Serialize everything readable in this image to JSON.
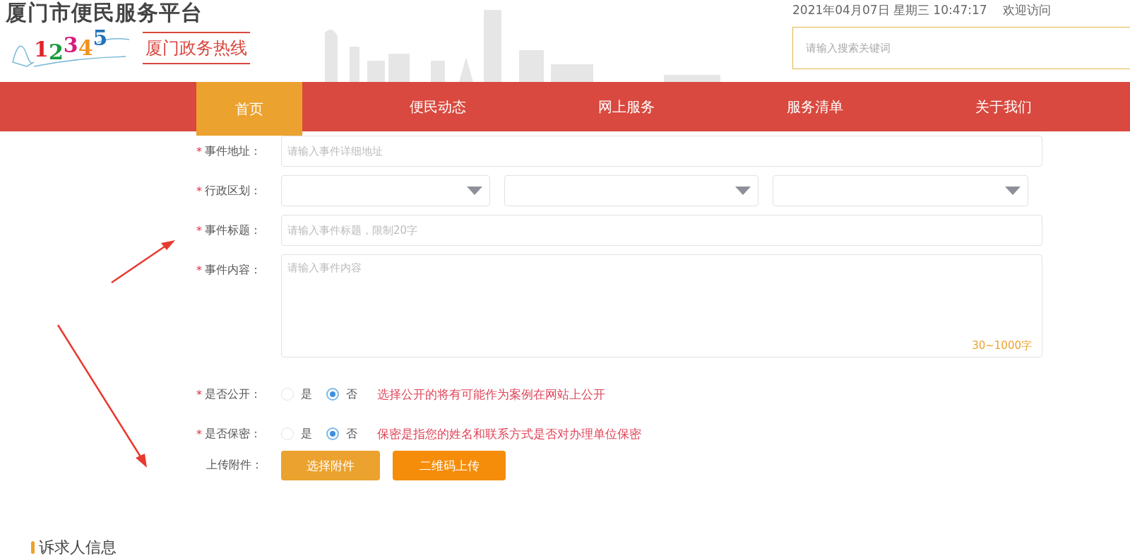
{
  "header": {
    "site_title": "厦门市便民服务平台",
    "logo_digits": [
      {
        "text": "1",
        "color": "#e2242b"
      },
      {
        "text": "2",
        "color": "#1a9a3c"
      },
      {
        "text": "3",
        "color": "#d81b7c"
      },
      {
        "text": "4",
        "color": "#f0931e"
      },
      {
        "text": "5",
        "color": "#2273b9"
      }
    ],
    "hotline": "厦门政务热线",
    "datetime": "2021年04月07日 星期三 10:47:17",
    "welcome": "欢迎访问",
    "search": {
      "placeholder": "请输入搜索关键词"
    }
  },
  "nav": [
    {
      "label": "首页",
      "selected": true
    },
    {
      "label": "便民动态",
      "selected": false
    },
    {
      "label": "网上服务",
      "selected": false
    },
    {
      "label": "服务清单",
      "selected": false
    },
    {
      "label": "关于我们",
      "selected": false
    }
  ],
  "form": [
    {
      "kind": "input",
      "mark": "*",
      "label": "事件地址：",
      "placeholder": "请输入事件详细地址"
    },
    {
      "kind": "selects",
      "mark": "*",
      "label": "行政区划："
    },
    {
      "kind": "input",
      "mark": "*",
      "label": "事件标题：",
      "placeholder": "请输入事件标题，限制20字"
    },
    {
      "kind": "textarea",
      "mark": "*",
      "label": "事件内容：",
      "placeholder": "请输入事件内容",
      "counter": "30~1000字"
    },
    {
      "kind": "radio",
      "mark": "*",
      "label": "是否公开：",
      "options": [
        {
          "label": "是",
          "selected": false
        },
        {
          "label": "否",
          "selected": true
        }
      ],
      "note": "选择公开的将有可能作为案例在网站上公开"
    },
    {
      "kind": "radio",
      "mark": "*",
      "label": "是否保密：",
      "options": [
        {
          "label": "是",
          "selected": false
        },
        {
          "label": "否",
          "selected": true
        }
      ],
      "note": "保密是指您的姓名和联系方式是否对办理单位保密"
    },
    {
      "kind": "upload",
      "label": "上传附件：",
      "buttons": [
        "选择附件",
        "二维码上传"
      ]
    }
  ],
  "section_heading": "诉求人信息"
}
